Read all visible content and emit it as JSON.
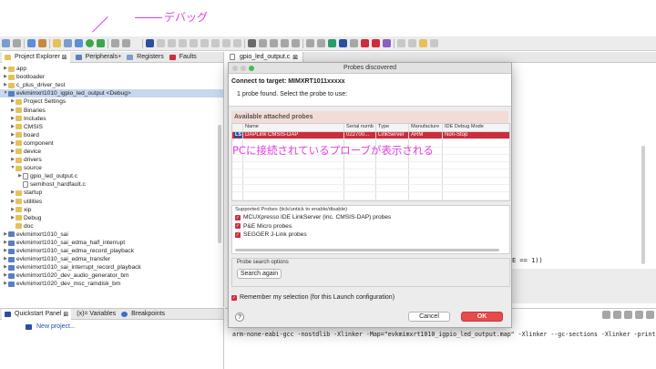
{
  "annotation": {
    "label": "デバッグ",
    "overlay_text": "PCに接続されているプローブが表示される"
  },
  "left_view_tabs": [
    {
      "label": "Project Explorer",
      "active": true
    },
    {
      "label": "Peripherals+",
      "active": false
    },
    {
      "label": "Registers",
      "active": false
    },
    {
      "label": "Faults",
      "active": false
    }
  ],
  "tree": [
    {
      "label": "app",
      "indent": 0,
      "type": "folder",
      "twisty": "▶"
    },
    {
      "label": "bootloader",
      "indent": 0,
      "type": "folder",
      "twisty": "▶"
    },
    {
      "label": "c_plus_driver_test",
      "indent": 0,
      "type": "folder",
      "twisty": "▶"
    },
    {
      "label": "evkmimxrt1010_igpio_led_output <Debug>",
      "indent": 0,
      "type": "project",
      "twisty": "▼",
      "selected": true
    },
    {
      "label": "Project Settings",
      "indent": 1,
      "type": "folder",
      "twisty": "▶"
    },
    {
      "label": "Binaries",
      "indent": 1,
      "type": "folder",
      "twisty": "▶"
    },
    {
      "label": "Includes",
      "indent": 1,
      "type": "folder",
      "twisty": "▶"
    },
    {
      "label": "CMSIS",
      "indent": 1,
      "type": "folder",
      "twisty": "▶"
    },
    {
      "label": "board",
      "indent": 1,
      "type": "folder",
      "twisty": "▶"
    },
    {
      "label": "component",
      "indent": 1,
      "type": "folder",
      "twisty": "▶"
    },
    {
      "label": "device",
      "indent": 1,
      "type": "folder",
      "twisty": "▶"
    },
    {
      "label": "drivers",
      "indent": 1,
      "type": "folder",
      "twisty": "▶"
    },
    {
      "label": "source",
      "indent": 1,
      "type": "folder",
      "twisty": "▼"
    },
    {
      "label": "gpio_led_output.c",
      "indent": 2,
      "type": "file",
      "twisty": "▶"
    },
    {
      "label": "semihost_hardfault.c",
      "indent": 2,
      "type": "file",
      "twisty": ""
    },
    {
      "label": "startup",
      "indent": 1,
      "type": "folder",
      "twisty": "▶"
    },
    {
      "label": "utilities",
      "indent": 1,
      "type": "folder",
      "twisty": "▶"
    },
    {
      "label": "xip",
      "indent": 1,
      "type": "folder",
      "twisty": "▶"
    },
    {
      "label": "Debug",
      "indent": 1,
      "type": "folder",
      "twisty": "▶"
    },
    {
      "label": "doc",
      "indent": 1,
      "type": "folder",
      "twisty": ""
    },
    {
      "label": "evkmimxrt1010_sai",
      "indent": 0,
      "type": "project",
      "twisty": "▶"
    },
    {
      "label": "evkmimxrt1010_sai_edma_half_interrupt",
      "indent": 0,
      "type": "project",
      "twisty": "▶"
    },
    {
      "label": "evkmimxrt1010_sai_edma_record_playback",
      "indent": 0,
      "type": "project",
      "twisty": "▶"
    },
    {
      "label": "evkmimxrt1010_sai_edma_transfer",
      "indent": 0,
      "type": "project",
      "twisty": "▶"
    },
    {
      "label": "evkmimxrt1010_sai_interrupt_record_playback",
      "indent": 0,
      "type": "project",
      "twisty": "▶"
    },
    {
      "label": "evkmimxrt1020_dev_audio_generator_bm",
      "indent": 0,
      "type": "project",
      "twisty": "▶"
    },
    {
      "label": "evkmimxrt1020_dev_msc_ramdisk_bm",
      "indent": 0,
      "type": "project",
      "twisty": "▶"
    }
  ],
  "bottom_left": {
    "tabs": [
      "Quickstart Panel",
      "(x)= Variables",
      "Breakpoints"
    ],
    "new_project": "New project..."
  },
  "editor": {
    "tab": "gpio_led_output.c",
    "fragment": "E == 1))"
  },
  "console": {
    "line": "arm-none-eabi-gcc -nostdlib -Xlinker -Map=\"evkmimxrt1010_igpio_led_output.map\" -Xlinker --gc-sections -Xlinker -print-memory-"
  },
  "dialog": {
    "title": "Probes discovered",
    "connect_label": "Connect to target: MIMXRT1011xxxxx",
    "found_text": "1 probe found. Select the probe to use:",
    "section_title": "Available attached probes",
    "columns": [
      "",
      "Name",
      "Serial numb",
      "Type",
      "Manufacture",
      "IDE Debug Mode"
    ],
    "probes": [
      {
        "badge": "LS",
        "name": "DAPLink CMSIS-DAP",
        "serial": "022700...",
        "type": "LinkServer",
        "manufacturer": "ARM",
        "mode": "Non-Stop"
      }
    ],
    "supported_title": "Supported Probes (tick/untick to enable/disable)",
    "supported": [
      "MCUXpresso IDE LinkServer (inc. CMSIS-DAP) probes",
      "P&E Micro probes",
      "SEGGER J-Link probes"
    ],
    "search_group_title": "Probe search options",
    "search_again": "Search again",
    "remember": "Remember my selection (for this Launch configuration)",
    "help": "?",
    "cancel": "Cancel",
    "ok": "OK"
  },
  "colors": {
    "accent": "#cc2d3d",
    "ok_button": "#e64a4a",
    "annotation": "#e040e0",
    "selection": "#c7d8ef"
  }
}
